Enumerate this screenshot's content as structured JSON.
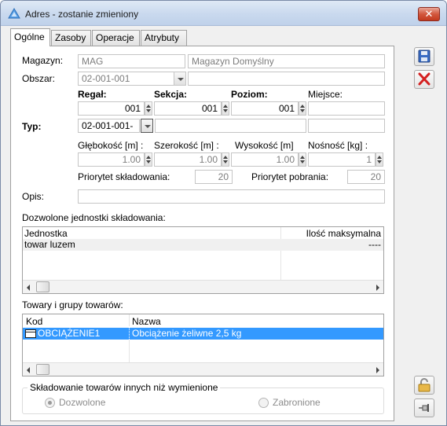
{
  "window": {
    "title": "Adres - zostanie zmieniony",
    "close_label": "✕"
  },
  "tabs": [
    {
      "label": "Ogólne"
    },
    {
      "label": "Zasoby"
    },
    {
      "label": "Operacje"
    },
    {
      "label": "Atrybuty"
    }
  ],
  "form": {
    "magazyn_label": "Magazyn:",
    "magazyn_code": "MAG",
    "magazyn_name": "Magazyn Domyślny",
    "obszar_label": "Obszar:",
    "obszar_value": "02-001-001",
    "obszar_desc": "",
    "regal_label": "Regał:",
    "sekcja_label": "Sekcja:",
    "poziom_label": "Poziom:",
    "miejsce_label": "Miejsce:",
    "regal_value": "001",
    "sekcja_value": "001",
    "poziom_value": "001",
    "miejsce_value": "",
    "typ_label": "Typ:",
    "typ_value": "02-001-001-",
    "typ_desc": "",
    "typ_extra": "",
    "glebokosc_label": "Głębokość [m] :",
    "szerokosc_label": "Szerokość [m] :",
    "wysokosc_label": "Wysokość [m]",
    "nosnosc_label": "Nośność [kg] :",
    "glebokosc_value": "1.00",
    "szerokosc_value": "1.00",
    "wysokosc_value": "1.00",
    "nosnosc_value": "1",
    "priorytet_skl_label": "Priorytet składowania:",
    "priorytet_skl_value": "20",
    "priorytet_pob_label": "Priorytet pobrania:",
    "priorytet_pob_value": "20",
    "opis_label": "Opis:",
    "opis_value": ""
  },
  "units_section": {
    "title": "Dozwolone jednostki składowania:",
    "columns": [
      "Jednostka",
      "Ilość maksymalna"
    ],
    "rows": [
      {
        "jednostka": "towar luzem",
        "ilosc": "----"
      }
    ]
  },
  "goods_section": {
    "title": "Towary i grupy towarów:",
    "columns": [
      "Kod",
      "Nazwa"
    ],
    "rows": [
      {
        "kod": "OBCIĄŻENIE1",
        "nazwa": "Obciążenie żeliwne 2,5 kg"
      }
    ]
  },
  "storage_group": {
    "title": "Składowanie towarów innych niż wymienione",
    "option_allowed": "Dozwolone",
    "option_forbidden": "Zabronione",
    "selected": "Dozwolone"
  },
  "icons": {
    "save": "save-icon",
    "cancel": "cancel-icon",
    "lock": "lock-icon",
    "pin": "pin-icon"
  },
  "colors": {
    "selection": "#3399ff",
    "cancel_red": "#d42020",
    "save_blue": "#2f5fb0"
  }
}
